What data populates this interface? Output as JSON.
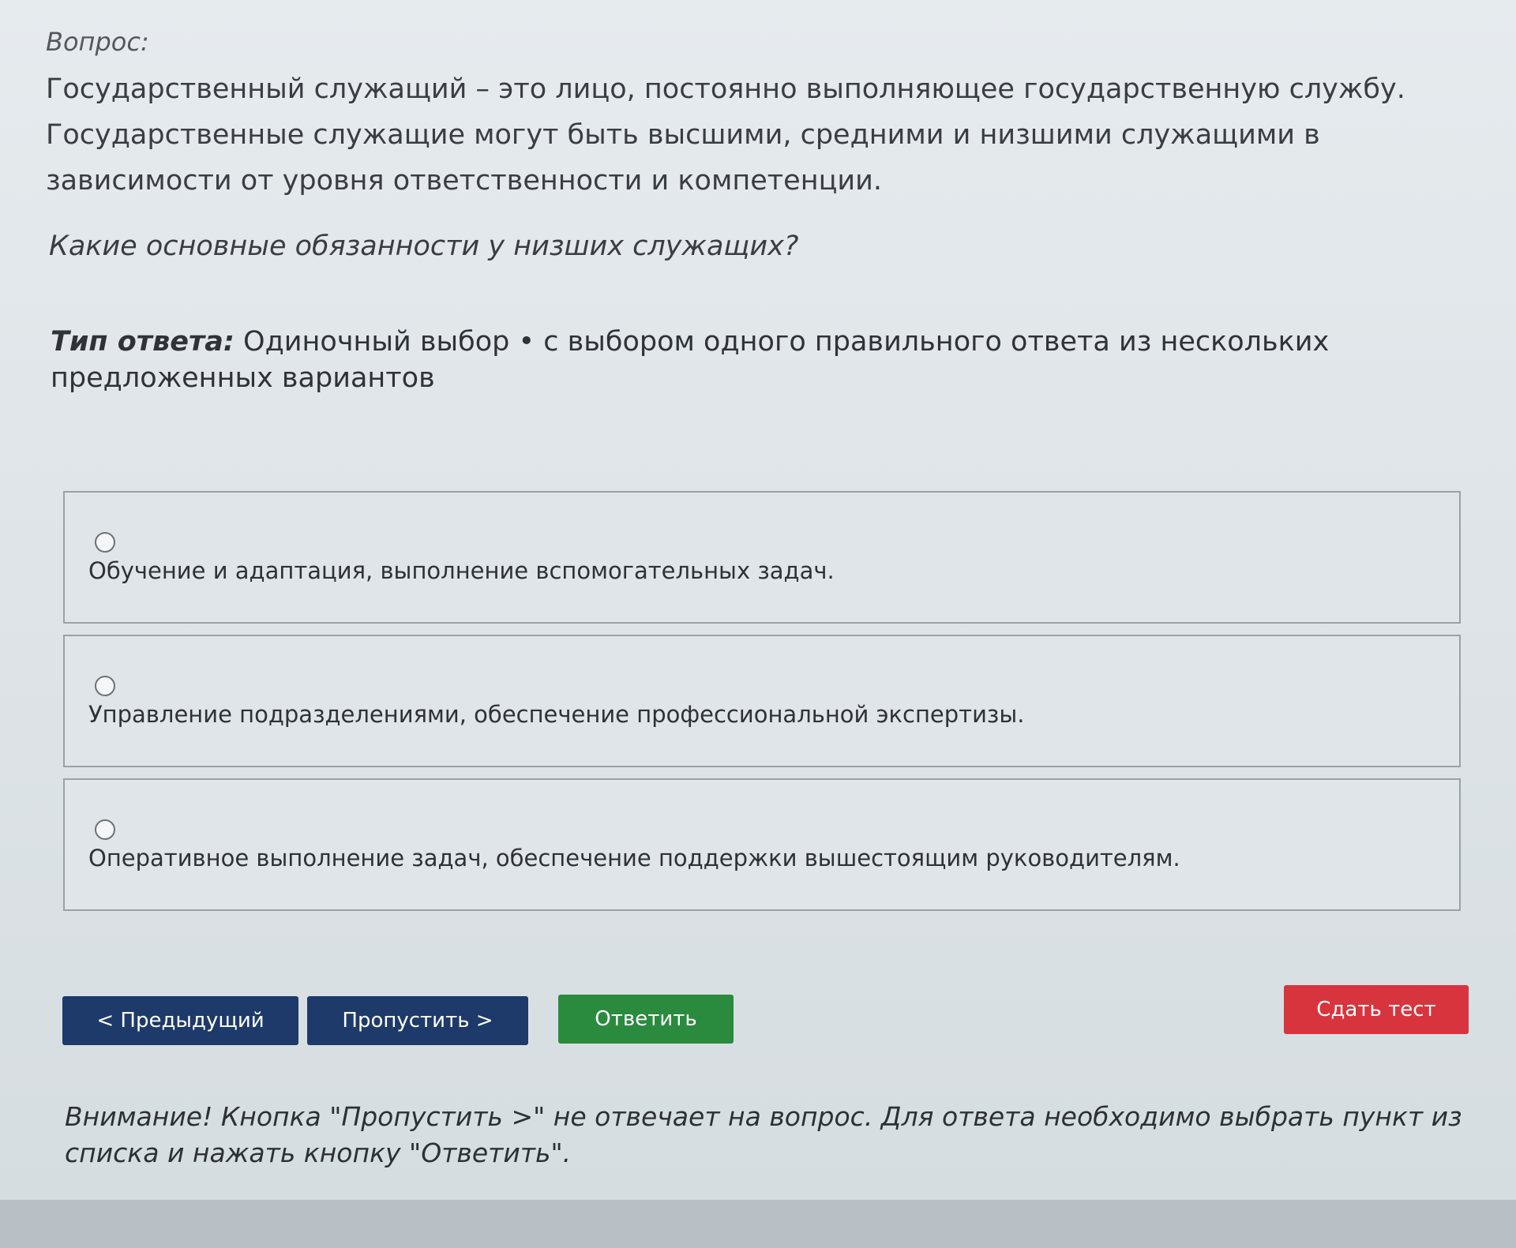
{
  "question": {
    "label": "Вопрос:",
    "text": "Государственный служащий – это лицо, постоянно выполняющее государственную службу. Государственные служащие могут быть высшими, средними и низшими служащими в зависимости от уровня ответственности и компетенции.",
    "ask": "Какие основные обязанности у низших служащих?"
  },
  "answer_type": {
    "label": "Тип ответа:",
    "value": "Одиночный выбор • с выбором одного правильного ответа из нескольких предложенных вариантов"
  },
  "options": [
    {
      "text": "Обучение и адаптация, выполнение вспомогательных задач."
    },
    {
      "text": "Управление подразделениями, обеспечение профессиональной экспертизы."
    },
    {
      "text": "Оперативное выполнение задач, обеспечение поддержки вышестоящим руководителям."
    }
  ],
  "buttons": {
    "prev": "< Предыдущий",
    "skip": "Пропустить >",
    "answer": "Ответить",
    "submit": "Сдать тест"
  },
  "warning": "Внимание! Кнопка \"Пропустить >\" не отвечает на вопрос. Для ответа необходимо выбрать пункт из списка и нажать кнопку \"Ответить\".",
  "colors": {
    "nav_button": "#1d3a6b",
    "answer_button": "#2a8a3e",
    "submit_button": "#d8343e"
  }
}
